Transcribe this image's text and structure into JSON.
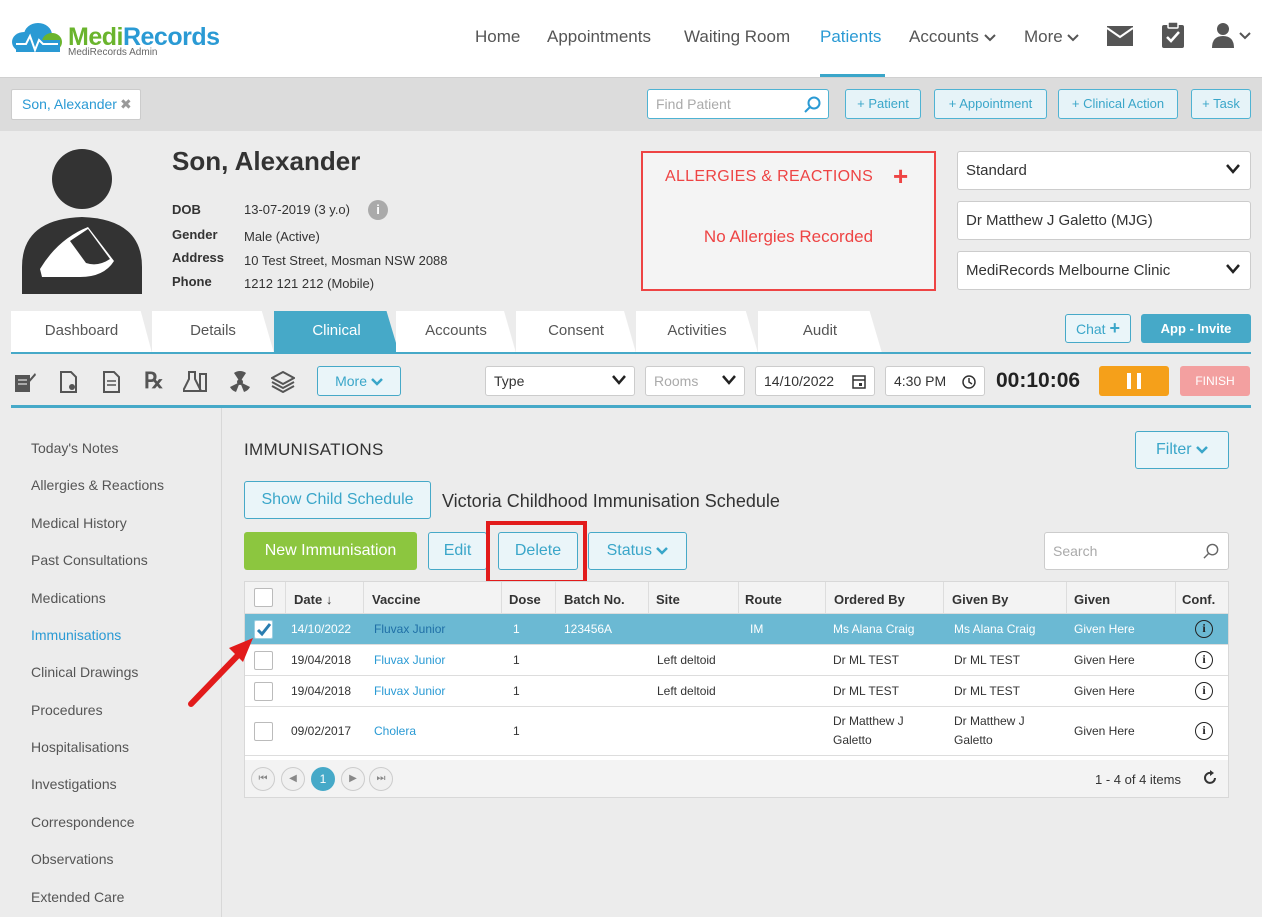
{
  "app": {
    "brand_left": "Medi",
    "brand_right": "Records",
    "brand_sub": "MediRecords Admin"
  },
  "nav": {
    "home": "Home",
    "appointments": "Appointments",
    "waiting_room": "Waiting Room",
    "patients": "Patients",
    "accounts": "Accounts",
    "more": "More"
  },
  "strip": {
    "patient_tab": "Son, Alexander",
    "find_placeholder": "Find Patient",
    "add_patient": "+ Patient",
    "add_appointment": "+ Appointment",
    "add_clinical_action": "+ Clinical Action",
    "add_task": "+ Task"
  },
  "patient": {
    "name": "Son, Alexander",
    "dob_label": "DOB",
    "dob": "13-07-2019 (3 y.o)",
    "gender_label": "Gender",
    "gender": "Male (Active)",
    "address_label": "Address",
    "address": "10 Test Street, Mosman NSW 2088",
    "phone_label": "Phone",
    "phone": "1212 121 212 (Mobile)"
  },
  "allergies": {
    "title": "ALLERGIES & REACTIONS",
    "status": "No Allergies Recorded"
  },
  "selectors": {
    "fee_type": "Standard",
    "provider": "Dr Matthew J Galetto (MJG)",
    "clinic": "MediRecords Melbourne Clinic"
  },
  "tabs": [
    "Dashboard",
    "Details",
    "Clinical",
    "Accounts",
    "Consent",
    "Activities",
    "Audit"
  ],
  "tab_actions": {
    "chat": "Chat",
    "app_invite": "App - Invite"
  },
  "toolbar": {
    "more": "More",
    "type": "Type",
    "rooms_placeholder": "Rooms",
    "date": "14/10/2022",
    "time": "4:30 PM",
    "timer": "00:10:06",
    "finish": "FINISH"
  },
  "sidenav": [
    "Today's Notes",
    "Allergies & Reactions",
    "Medical History",
    "Past Consultations",
    "Medications",
    "Immunisations",
    "Clinical Drawings",
    "Procedures",
    "Hospitalisations",
    "Investigations",
    "Correspondence",
    "Observations",
    "Extended Care"
  ],
  "sidenav_active": "Immunisations",
  "immunisations": {
    "heading": "IMMUNISATIONS",
    "filter": "Filter",
    "show_child_schedule": "Show Child Schedule",
    "schedule_name": "Victoria Childhood Immunisation Schedule",
    "new_button": "New Immunisation",
    "edit": "Edit",
    "delete": "Delete",
    "status": "Status",
    "search_placeholder": "Search",
    "columns": [
      "Date",
      "Vaccine",
      "Dose",
      "Batch No.",
      "Site",
      "Route",
      "Ordered By",
      "Given By",
      "Given",
      "Conf."
    ],
    "rows": [
      {
        "checked": true,
        "date": "14/10/2022",
        "vaccine": "Fluvax Junior",
        "dose": "1",
        "batch": "123456A",
        "site": "",
        "route": "IM",
        "ordered_1": "Ms Alana Craig",
        "ordered_2": "",
        "given_by_1": "Ms Alana Craig",
        "given_by_2": "",
        "given": "Given Here"
      },
      {
        "checked": false,
        "date": "19/04/2018",
        "vaccine": "Fluvax Junior",
        "dose": "1",
        "batch": "",
        "site": "Left deltoid",
        "route": "",
        "ordered_1": "Dr ML TEST",
        "ordered_2": "",
        "given_by_1": "Dr ML TEST",
        "given_by_2": "",
        "given": "Given Here"
      },
      {
        "checked": false,
        "date": "19/04/2018",
        "vaccine": "Fluvax Junior",
        "dose": "1",
        "batch": "",
        "site": "Left deltoid",
        "route": "",
        "ordered_1": "Dr ML TEST",
        "ordered_2": "",
        "given_by_1": "Dr ML TEST",
        "given_by_2": "",
        "given": "Given Here"
      },
      {
        "checked": false,
        "date": "09/02/2017",
        "vaccine": "Cholera",
        "dose": "1",
        "batch": "",
        "site": "",
        "route": "",
        "ordered_1": "Dr Matthew J",
        "ordered_2": "Galetto",
        "given_by_1": "Dr Matthew J",
        "given_by_2": "Galetto",
        "given": "Given Here"
      }
    ],
    "current_page": "1",
    "items_text": "1 - 4 of 4 items"
  },
  "colors": {
    "accent": "#46a9c8",
    "brand_green": "#6ab42d",
    "brand_blue": "#2a9ad4",
    "alert_red": "#e44444",
    "new_button": "#8cc63f",
    "pause": "#f5a01a",
    "highlight_box": "#e21b1b"
  }
}
